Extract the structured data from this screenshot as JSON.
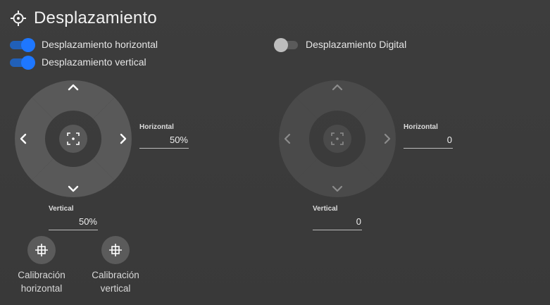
{
  "header": {
    "title": "Desplazamiento",
    "icon": "crosshair-icon"
  },
  "toggles": {
    "horizontal": {
      "label": "Desplazamiento horizontal",
      "state": "on"
    },
    "vertical": {
      "label": "Desplazamiento vertical",
      "state": "on"
    },
    "digital": {
      "label": "Desplazamiento Digital",
      "state": "off"
    }
  },
  "left_panel": {
    "horizontal": {
      "label": "Horizontal",
      "value": "50%"
    },
    "vertical": {
      "label": "Vertical",
      "value": "50%"
    }
  },
  "right_panel": {
    "horizontal": {
      "label": "Horizontal",
      "value": "0"
    },
    "vertical": {
      "label": "Vertical",
      "value": "0"
    }
  },
  "calibration": {
    "horizontal": {
      "line1": "Calibración",
      "line2": "horizontal"
    },
    "vertical": {
      "line1": "Calibración",
      "line2": "vertical"
    }
  },
  "colors": {
    "accent": "#1e77ff",
    "background": "#3a3a3a",
    "pad": "#595959"
  }
}
